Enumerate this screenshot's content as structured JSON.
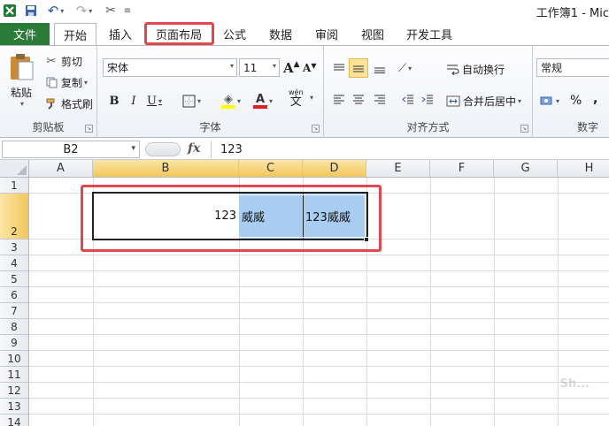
{
  "window": {
    "title": "工作簿1 - Mic",
    "qat": {
      "excel_icon": "excel-icon",
      "save_icon": "save-icon",
      "undo_icon": "undo-icon",
      "redo_icon": "redo-icon",
      "custom_icon": "customize-icon"
    }
  },
  "tabs": {
    "file": "文件",
    "items": [
      "开始",
      "插入",
      "页面布局",
      "公式",
      "数据",
      "审阅",
      "视图",
      "开发工具"
    ],
    "active": "开始",
    "highlighted": "页面布局"
  },
  "ribbon": {
    "clipboard": {
      "label": "剪贴板",
      "paste": "粘贴",
      "cut": "剪切",
      "copy": "复制",
      "format_painter": "格式刷"
    },
    "font": {
      "label": "字体",
      "font_name": "宋体",
      "font_size": "11",
      "bold": "B",
      "italic": "I",
      "underline": "U",
      "wen": "wén",
      "wen_char": "文",
      "grow": "A",
      "shrink": "A",
      "font_color_glyph": "A"
    },
    "alignment": {
      "label": "对齐方式",
      "wrap_text": "自动换行",
      "merge_center": "合并后居中"
    },
    "number": {
      "label": "数字",
      "format": "常规",
      "percent": "%",
      "comma": ","
    }
  },
  "formula_bar": {
    "name_box": "B2",
    "fx": "fx",
    "value": "123"
  },
  "sheet": {
    "columns": [
      "A",
      "B",
      "C",
      "D",
      "E",
      "F",
      "G",
      "H"
    ],
    "selected_columns": [
      "B",
      "C",
      "D"
    ],
    "rows": [
      "1",
      "2",
      "3",
      "4",
      "5",
      "6",
      "7",
      "8",
      "9",
      "10",
      "11",
      "12",
      "13",
      "14"
    ],
    "selected_row": "2",
    "cells": {
      "B2": "123",
      "C2": "威威",
      "D2": "123威威"
    }
  },
  "colors": {
    "file_tab": "#2a7a38",
    "highlight_box": "#e0484e",
    "selection_fill": "#a9cdf0",
    "header_selected": "#f2c75c"
  },
  "watermark": "Sh..."
}
